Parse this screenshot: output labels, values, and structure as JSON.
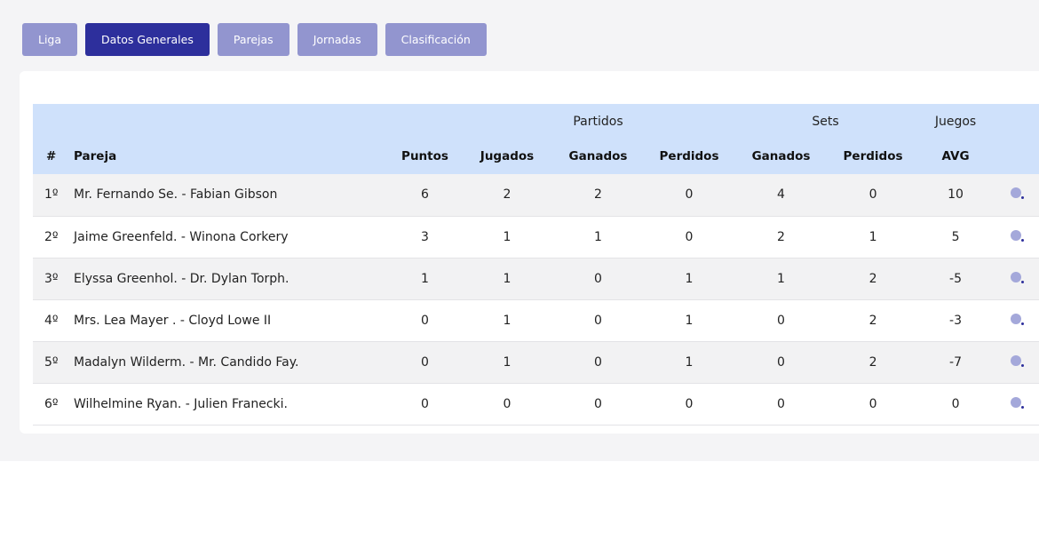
{
  "tabs": [
    {
      "label": "Liga",
      "active": false
    },
    {
      "label": "Datos Generales",
      "active": true
    },
    {
      "label": "Parejas",
      "active": false
    },
    {
      "label": "Jornadas",
      "active": false
    },
    {
      "label": "Clasificación",
      "active": false
    }
  ],
  "table": {
    "group_headers": {
      "partidos": "Partidos",
      "sets": "Sets",
      "juegos": "Juegos"
    },
    "columns": [
      "#",
      "Pareja",
      "Puntos",
      "Jugados",
      "Ganados",
      "Perdidos",
      "Ganados",
      "Perdidos",
      "AVG"
    ],
    "rows": [
      {
        "pos": "1º",
        "pair": "Mr. Fernando Se. - Fabian Gibson",
        "puntos": "6",
        "jugados": "2",
        "ganados": "2",
        "perdidos": "0",
        "sets_ganados": "4",
        "sets_perdidos": "0",
        "avg": "10"
      },
      {
        "pos": "2º",
        "pair": "Jaime Greenfeld. - Winona Corkery",
        "puntos": "3",
        "jugados": "1",
        "ganados": "1",
        "perdidos": "0",
        "sets_ganados": "2",
        "sets_perdidos": "1",
        "avg": "5"
      },
      {
        "pos": "3º",
        "pair": "Elyssa Greenhol. - Dr. Dylan Torph.",
        "puntos": "1",
        "jugados": "1",
        "ganados": "0",
        "perdidos": "1",
        "sets_ganados": "1",
        "sets_perdidos": "2",
        "avg": "-5"
      },
      {
        "pos": "4º",
        "pair": "Mrs. Lea Mayer . - Cloyd Lowe II",
        "puntos": "0",
        "jugados": "1",
        "ganados": "0",
        "perdidos": "1",
        "sets_ganados": "0",
        "sets_perdidos": "2",
        "avg": "-3"
      },
      {
        "pos": "5º",
        "pair": "Madalyn Wilderm. - Mr. Candido Fay.",
        "puntos": "0",
        "jugados": "1",
        "ganados": "0",
        "perdidos": "1",
        "sets_ganados": "0",
        "sets_perdidos": "2",
        "avg": "-7"
      },
      {
        "pos": "6º",
        "pair": "Wilhelmine Ryan. - Julien Franecki.",
        "puntos": "0",
        "jugados": "0",
        "ganados": "0",
        "perdidos": "0",
        "sets_ganados": "0",
        "sets_perdidos": "0",
        "avg": "0"
      }
    ],
    "row_icon": "search-icon"
  },
  "colors": {
    "tab": "#9295cf",
    "tab_active": "#2d2f9c",
    "header_bg": "#cfe1fb",
    "row_alt": "#f2f2f3",
    "page_bg": "#f4f4f6"
  }
}
